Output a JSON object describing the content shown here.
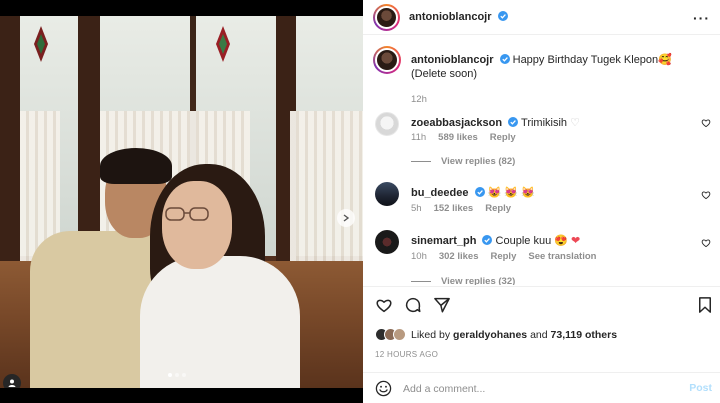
{
  "post": {
    "author": "antonioblancojr",
    "verified_color": "#3897f0",
    "caption_text": "Happy Birthday Tugek Klepon",
    "caption_emoji": "🥰",
    "caption_suffix": "(Delete soon)",
    "caption_age": "12h",
    "carousel": {
      "slides": 3,
      "active_index": 0
    }
  },
  "comments": [
    {
      "username": "zoeabbasjackson",
      "verified": true,
      "text": "Trimikisih ",
      "heart_emoji": "♡",
      "age": "11h",
      "likes": "589 likes",
      "reply": "Reply",
      "view_replies": "View replies (82)"
    },
    {
      "username": "bu_deedee",
      "verified": true,
      "text": "😻 😻 😻",
      "age": "5h",
      "likes": "152 likes",
      "reply": "Reply"
    },
    {
      "username": "sinemart_ph",
      "verified": true,
      "text": "Couple kuu",
      "text_emoji": "😍",
      "text_heart": "❤",
      "age": "10h",
      "likes": "302 likes",
      "reply": "Reply",
      "translation": "See translation",
      "view_replies": "View replies (32)"
    }
  ],
  "engagement": {
    "liked_prefix": "Liked by",
    "liked_user": "geraldyohanes",
    "liked_and": "and",
    "liked_count": "73,119 others",
    "time": "12 HOURS AGO"
  },
  "add_comment": {
    "placeholder": "Add a comment...",
    "post_label": "Post"
  },
  "icons": {
    "more": "more-options-icon",
    "like": "heart-icon",
    "comment": "comment-icon",
    "share": "share-icon",
    "save": "bookmark-icon",
    "emoji": "emoji-icon",
    "next": "chevron-right-icon",
    "tag": "user-tag-icon"
  },
  "colors": {
    "accent": "#0095f6",
    "muted": "#8e8e8e",
    "heart_red": "#ed4956"
  }
}
